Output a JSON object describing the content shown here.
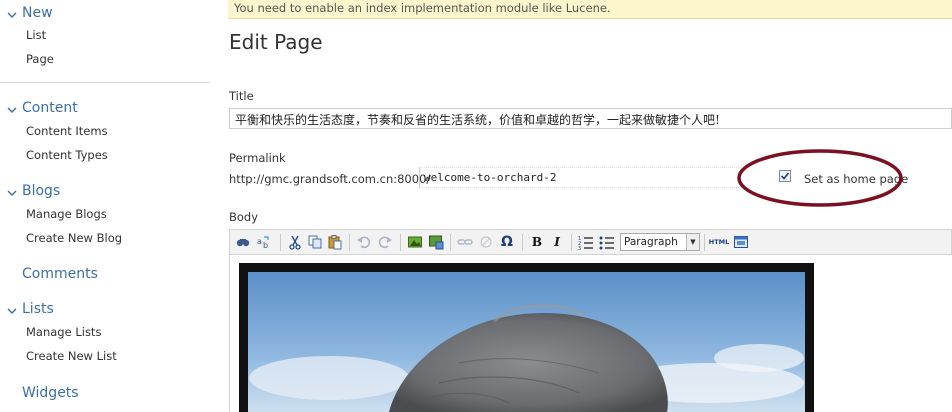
{
  "sidebar": {
    "sections": [
      {
        "title": "New",
        "items": [
          "List",
          "Page"
        ],
        "collapsible": true
      },
      {
        "title": "Content",
        "items": [
          "Content Items",
          "Content Types"
        ],
        "collapsible": true
      },
      {
        "title": "Blogs",
        "items": [
          "Manage Blogs",
          "Create New Blog"
        ],
        "collapsible": true
      },
      {
        "title": "Comments",
        "items": [],
        "collapsible": false
      },
      {
        "title": "Lists",
        "items": [
          "Manage Lists",
          "Create New List"
        ],
        "collapsible": true
      },
      {
        "title": "Widgets",
        "items": [],
        "collapsible": false
      }
    ]
  },
  "notice": "You need to enable an index implementation module like Lucene.",
  "page_title": "Edit Page",
  "form": {
    "title_label": "Title",
    "title_value": "平衡和快乐的生活态度，节奏和反省的生活系统，价值和卓越的哲学，一起来做敏捷个人吧!",
    "permalink_label": "Permalink",
    "permalink_prefix": "http://gmc.grandsoft.com.cn:8000/",
    "permalink_slug": "welcome-to-orchard-2",
    "home_page_label": "Set as home page",
    "home_page_checked": true,
    "body_label": "Body"
  },
  "toolbar": {
    "format_value": "Paragraph",
    "icons": [
      "find-icon",
      "replace-icon",
      "cut-icon",
      "copy-icon",
      "paste-icon",
      "undo-icon",
      "redo-icon",
      "insert-image-icon",
      "insert-media-icon",
      "link-icon",
      "unlink-icon",
      "special-char-icon",
      "bold-icon",
      "italic-icon",
      "numbered-list-icon",
      "bullet-list-icon",
      "html-source-icon",
      "fullscreen-icon"
    ],
    "bold_glyph": "B",
    "italic_glyph": "I",
    "omega_glyph": "Ω",
    "html_glyph": "HTML"
  },
  "colors": {
    "accent": "#3a6fa5",
    "notice_bg": "#fdf5cc",
    "annotation": "#7a1020"
  }
}
